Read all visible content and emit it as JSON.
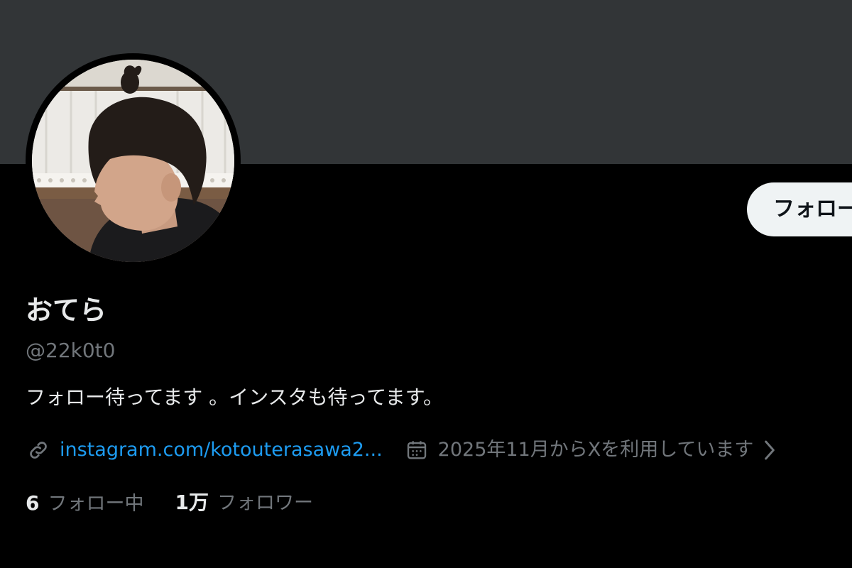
{
  "profile": {
    "display_name": "おてら",
    "handle": "@22k0t0",
    "bio": "フォロー待ってます 。インスタも待ってます。",
    "link": "instagram.com/kotouterasawa2...",
    "joined": "2025年11月からXを利用しています",
    "follow_button_label": "フォロー",
    "avatar_alt": "profile photo",
    "stats": {
      "following_count": "6",
      "following_label": "フォロー中",
      "followers_count": "1万",
      "followers_label": "フォロワー"
    }
  },
  "colors": {
    "background": "#000000",
    "banner": "#323537",
    "primary_text": "#e7e9ea",
    "secondary_text": "#71767b",
    "link": "#1d9bf0",
    "follow_button_bg": "#eff3f4",
    "follow_button_text": "#0f1419"
  },
  "icons": {
    "link": "link-icon",
    "calendar": "calendar-icon",
    "chevron": "chevron-right-icon"
  }
}
